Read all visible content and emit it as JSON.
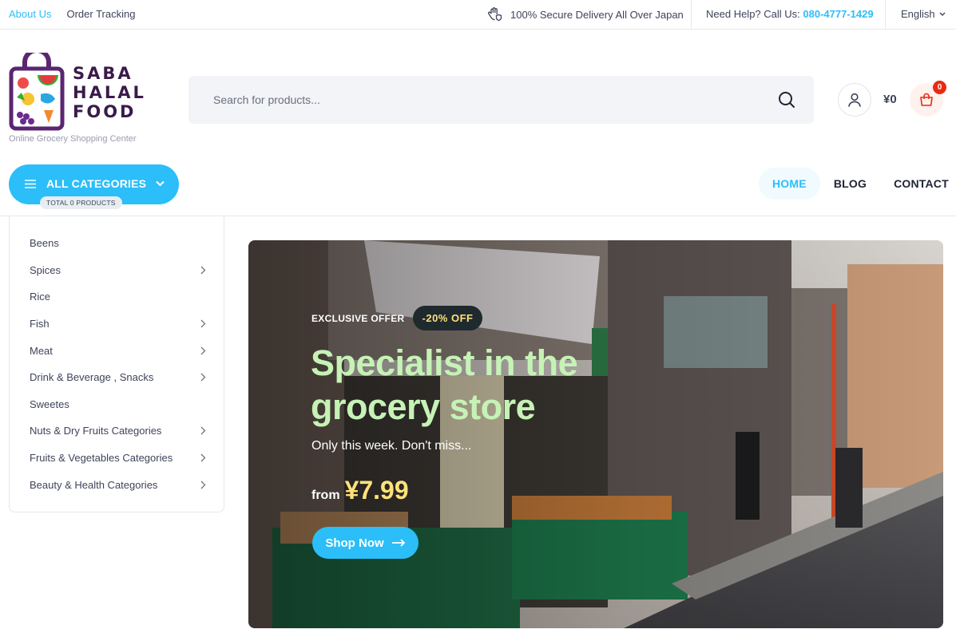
{
  "topbar": {
    "links": [
      "About Us",
      "Order Tracking"
    ],
    "secure_text": "100% Secure Delivery All Over Japan",
    "help_label": "Need Help? Call Us:",
    "help_phone": "080-4777-1429",
    "language": "English"
  },
  "brand": {
    "line1": "SABA",
    "line2": "HALAL",
    "line3": "FOOD",
    "tagline": "Online Grocery Shopping Center"
  },
  "search": {
    "placeholder": "Search for products..."
  },
  "cart": {
    "total": "¥0",
    "count": "0"
  },
  "categories_button": {
    "label": "ALL CATEGORIES",
    "total": "TOTAL 0 PRODUCTS"
  },
  "nav": [
    "HOME",
    "BLOG",
    "CONTACT"
  ],
  "sidebar": [
    {
      "label": "Beens",
      "has_children": false
    },
    {
      "label": "Spices",
      "has_children": true
    },
    {
      "label": "Rice",
      "has_children": false
    },
    {
      "label": "Fish",
      "has_children": true
    },
    {
      "label": "Meat",
      "has_children": true
    },
    {
      "label": "Drink & Beverage , Snacks",
      "has_children": true
    },
    {
      "label": "Sweetes",
      "has_children": false
    },
    {
      "label": "Nuts & Dry Fruits Categories",
      "has_children": true
    },
    {
      "label": "Fruits & Vegetables Categories",
      "has_children": true
    },
    {
      "label": "Beauty & Health Categories",
      "has_children": true
    }
  ],
  "hero": {
    "offer_label": "EXCLUSIVE OFFER",
    "discount": "-20% OFF",
    "title": "Specialist in the grocery store",
    "subtitle": "Only this week. Don't miss...",
    "from": "from",
    "price": "¥7.99",
    "button": "Shop Now"
  },
  "colors": {
    "accent": "#2bbef9",
    "hero_title": "#c6f2b6",
    "price": "#ffe27a",
    "badge": "#ea2b0f"
  }
}
